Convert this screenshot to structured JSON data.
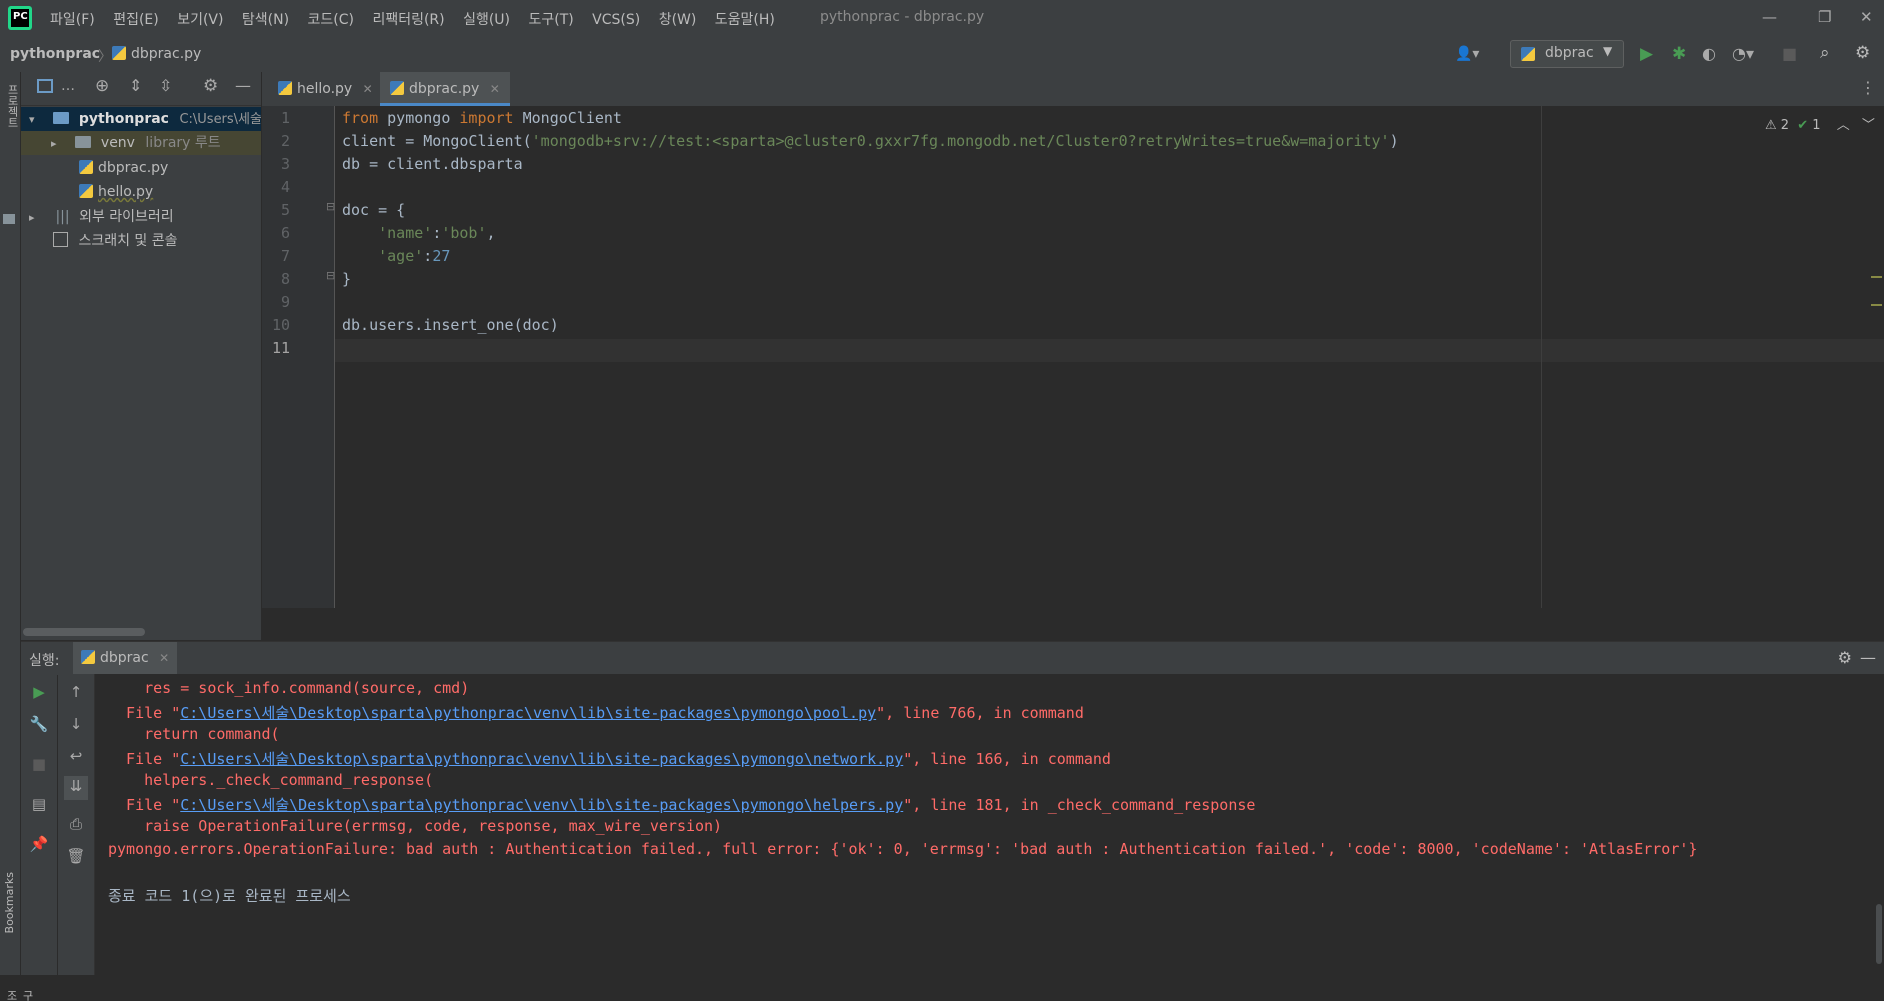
{
  "window": {
    "title": "pythonprac - dbprac.py",
    "menu": [
      "파일(F)",
      "편집(E)",
      "보기(V)",
      "탐색(N)",
      "코드(C)",
      "리팩터링(R)",
      "실행(U)",
      "도구(T)",
      "VCS(S)",
      "창(W)",
      "도움말(H)"
    ]
  },
  "breadcrumb": {
    "project": "pythonprac",
    "file": "dbprac.py"
  },
  "toolbar": {
    "run_config": "dbprac"
  },
  "left_strip": {
    "project_tab": "프로젝트",
    "bookmarks": "Bookmarks",
    "structure": "구조"
  },
  "project_tree": {
    "root_name": "pythonprac",
    "root_path": "C:\\Users\\세술",
    "venv": "venv",
    "venv_hint": "library 루트",
    "files": [
      "dbprac.py",
      "hello.py"
    ],
    "external_libs": "외부 라이브러리",
    "scratches": "스크래치 및 콘솔"
  },
  "editor": {
    "tabs": [
      "hello.py",
      "dbprac.py"
    ],
    "active_tab": "dbprac.py",
    "inspections": {
      "warnings": "2",
      "ok": "1"
    },
    "line_numbers": [
      "1",
      "2",
      "3",
      "4",
      "5",
      "6",
      "7",
      "8",
      "9",
      "10",
      "11"
    ]
  },
  "run_panel": {
    "label": "실행:",
    "tab": "dbprac",
    "output": {
      "l1": "    res = sock_info.command(source, cmd)",
      "l2_pre": "  File \"",
      "l2_link": "C:\\Users\\세술\\Desktop\\sparta\\pythonprac\\venv\\lib\\site-packages\\pymongo\\pool.py",
      "l2_post": "\", line 766, in command",
      "l3": "    return command(",
      "l4_pre": "  File \"",
      "l4_link": "C:\\Users\\세술\\Desktop\\sparta\\pythonprac\\venv\\lib\\site-packages\\pymongo\\network.py",
      "l4_post": "\", line 166, in command",
      "l5": "    helpers._check_command_response(",
      "l6_pre": "  File \"",
      "l6_link": "C:\\Users\\세술\\Desktop\\sparta\\pythonprac\\venv\\lib\\site-packages\\pymongo\\helpers.py",
      "l6_post": "\", line 181, in _check_command_response",
      "l7": "    raise OperationFailure(errmsg, code, response, max_wire_version)",
      "l8": "pymongo.errors.OperationFailure: bad auth : Authentication failed., full error: {'ok': 0, 'errmsg': 'bad auth : Authentication failed.', 'code': 8000, 'codeName': 'AtlasError'}",
      "l9": "종료 코드 1(으)로 완료된 프로세스"
    }
  },
  "colors": {
    "accent": "#4a88c7",
    "error": "#ff6b68",
    "link": "#589df6"
  }
}
